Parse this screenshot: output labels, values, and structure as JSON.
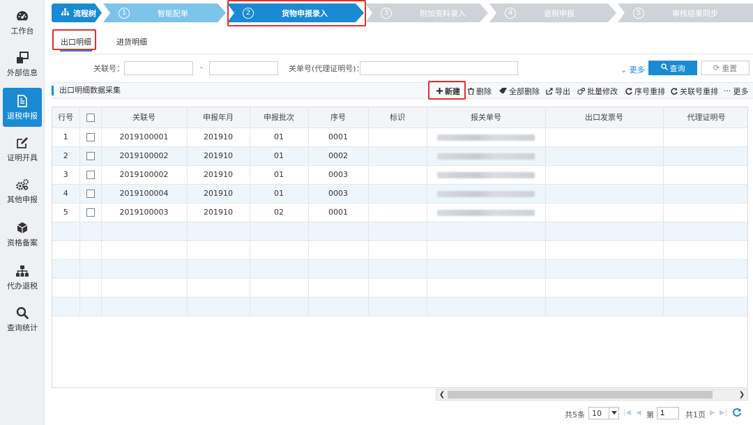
{
  "sidebar": {
    "items": [
      {
        "label": "工作台",
        "icon": "dashboard-icon"
      },
      {
        "label": "外部信息",
        "icon": "external-info-icon"
      },
      {
        "label": "退税申报",
        "icon": "document-icon"
      },
      {
        "label": "证明开具",
        "icon": "edit-icon"
      },
      {
        "label": "其他申报",
        "icon": "gears-icon"
      },
      {
        "label": "资格备案",
        "icon": "cube-icon"
      },
      {
        "label": "代办退税",
        "icon": "org-tree-icon"
      },
      {
        "label": "查询统计",
        "icon": "search-icon"
      }
    ],
    "active_index": 2
  },
  "steps": {
    "root_label": "流程树",
    "items": [
      {
        "num": "1",
        "label": "智能配单"
      },
      {
        "num": "2",
        "label": "货物申报录入"
      },
      {
        "num": "3",
        "label": "附加资料录入"
      },
      {
        "num": "4",
        "label": "退税申报"
      },
      {
        "num": "5",
        "label": "审核结果同步"
      }
    ]
  },
  "tabs": [
    "出口明细",
    "进货明细"
  ],
  "filter": {
    "link_no_label": "关联号：",
    "range_sep": "-",
    "customs_no_label": "关单号(代理证明号)：",
    "more_label": "更多",
    "query_label": "查询",
    "reset_label": "重置"
  },
  "toolbar": {
    "title": "出口明细数据采集",
    "new_label": "新建",
    "delete_label": "删除",
    "delete_all_label": "全部删除",
    "export_label": "导出",
    "batch_edit_label": "批量修改",
    "reorder_seq_label": "序号重排",
    "reorder_link_label": "关联号重排",
    "more_label": "更多"
  },
  "table": {
    "columns": [
      "行号",
      "",
      "关联号",
      "申报年月",
      "申报批次",
      "序号",
      "标识",
      "报关单号",
      "出口发票号",
      "代理证明号"
    ],
    "rows": [
      {
        "row": "1",
        "link_no": "2019100001",
        "period": "201910",
        "batch": "01",
        "seq": "0001",
        "flag": ""
      },
      {
        "row": "2",
        "link_no": "2019100002",
        "period": "201910",
        "batch": "01",
        "seq": "0002",
        "flag": ""
      },
      {
        "row": "3",
        "link_no": "2019100002",
        "period": "201910",
        "batch": "01",
        "seq": "0003",
        "flag": ""
      },
      {
        "row": "4",
        "link_no": "2019100004",
        "period": "201910",
        "batch": "01",
        "seq": "0003",
        "flag": ""
      },
      {
        "row": "5",
        "link_no": "2019100003",
        "period": "201910",
        "batch": "02",
        "seq": "0001",
        "flag": ""
      }
    ],
    "empty_rows": 5
  },
  "pager": {
    "total": "共5条",
    "page_size": "10",
    "page_label": "第",
    "page_value": "1",
    "total_pages": "共1页"
  },
  "colors": {
    "accent": "#1a8ad4",
    "step_done": "#7dc3ea",
    "step_pending": "#cfd3d8",
    "highlight": "#e52e2e"
  }
}
